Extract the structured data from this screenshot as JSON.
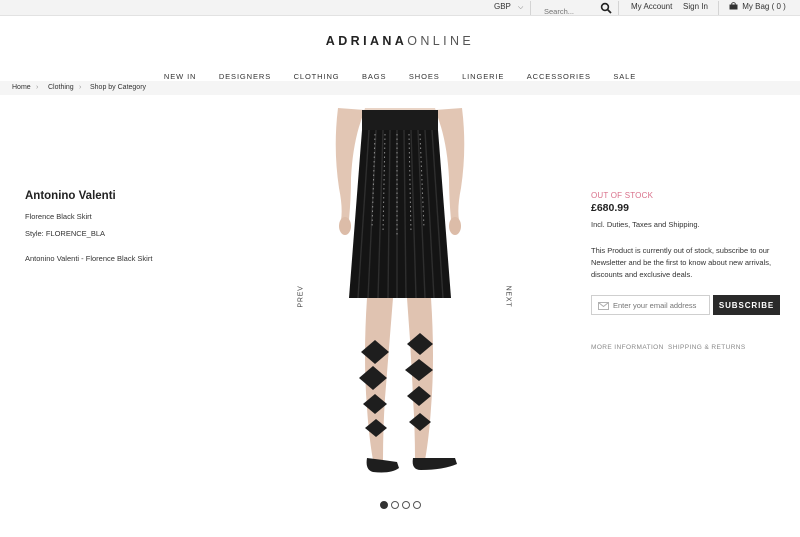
{
  "topbar": {
    "currency": "GBP",
    "search_placeholder": "Search...",
    "my_account": "My Account",
    "sign_in": "Sign In",
    "bag": "My Bag",
    "bag_count": "( 0 )"
  },
  "header": {
    "logo_bold": "ADRIANA",
    "logo_light": "ONLINE",
    "nav": [
      "NEW IN",
      "DESIGNERS",
      "CLOTHING",
      "BAGS",
      "SHOES",
      "LINGERIE",
      "ACCESSORIES",
      "SALE"
    ]
  },
  "breadcrumb": [
    "Home",
    "Clothing",
    "Shop by Category"
  ],
  "product": {
    "brand": "Antonino Valenti",
    "name": "Florence Black Skirt",
    "style": "Style: FLORENCE_BLA",
    "description": "Antonino Valenti - Florence Black Skirt",
    "gallery": {
      "prev": "PREV",
      "next": "NEXT",
      "slides": 4,
      "active_slide": 1
    }
  },
  "purchase": {
    "stock_status": "OUT OF STOCK",
    "price": "£680.99",
    "duties": "Incl. Duties, Taxes and Shipping.",
    "notice": "This Product is currently out of stock, subscribe to our Newsletter and be the first to know about new arrivals, discounts and exclusive deals.",
    "email_placeholder": "Enter your email address",
    "subscribe": "SUBSCRIBE",
    "more_info": "MORE INFORMATION",
    "shipping": "SHIPPING & RETURNS"
  },
  "colors": {
    "out_of_stock": "#d9708a",
    "button": "#2a2a2a",
    "topbar_bg": "#f3f3f3"
  },
  "icons": [
    "search-icon",
    "bag-icon",
    "chevron-down-icon",
    "chevron-right-icon",
    "mail-icon"
  ]
}
